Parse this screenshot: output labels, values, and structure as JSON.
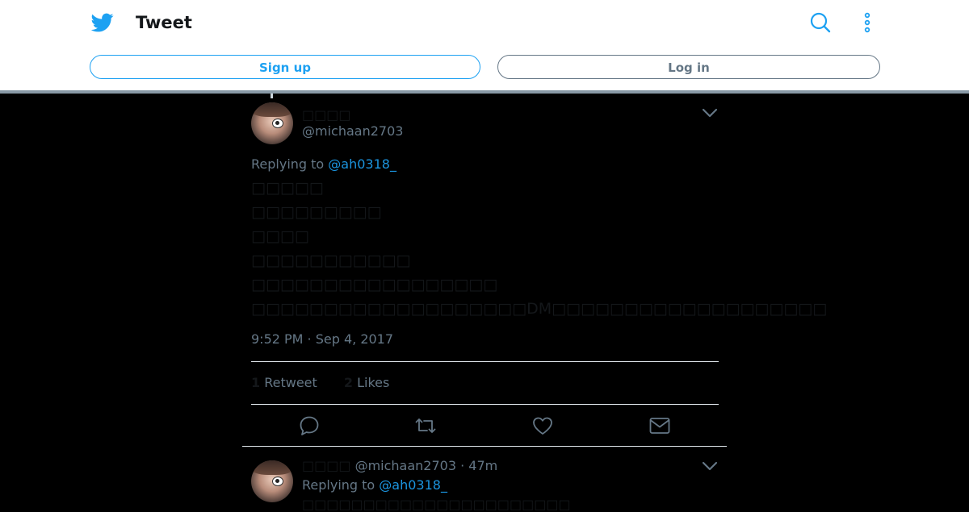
{
  "header": {
    "title": "Tweet",
    "signup_label": "Sign up",
    "login_label": "Log in"
  },
  "tweet": {
    "display_name": "□□□□",
    "handle": "@michaan2703",
    "replying_prefix": "Replying to",
    "replying_to": "@ah0318_",
    "text_lines": [
      "□□□□□",
      "□□□□□□□□□",
      "□□□□",
      "□□□□□□□□□□□",
      "□□□□□□□□□□□□□□□□□",
      "□□□□□□□□□□□□□□□□□□□DM□□□□□□□□□□□□□□□□□□□"
    ],
    "timestamp": "9:52 PM · Sep 4, 2017",
    "retweet_count": "1",
    "retweet_label": "Retweet",
    "like_count": "2",
    "like_label": "Likes"
  },
  "reply": {
    "display_name": "□□□□",
    "handle_time": "@michaan2703 · 47m",
    "replying_prefix": "Replying to",
    "replying_to": "@ah0318_",
    "text": "□□□□□□□□□□□□□□□□□□□□□□"
  },
  "icons": {
    "brand": "twitter-bird-icon",
    "search": "search-icon",
    "more": "more-vertical-icon",
    "caret": "chevron-down-icon",
    "reply": "reply-icon",
    "retweet": "retweet-icon",
    "like": "heart-icon",
    "dm": "envelope-icon"
  },
  "colors": {
    "accent": "#1da1f2",
    "link": "#1b95e0",
    "muted": "#657786"
  }
}
